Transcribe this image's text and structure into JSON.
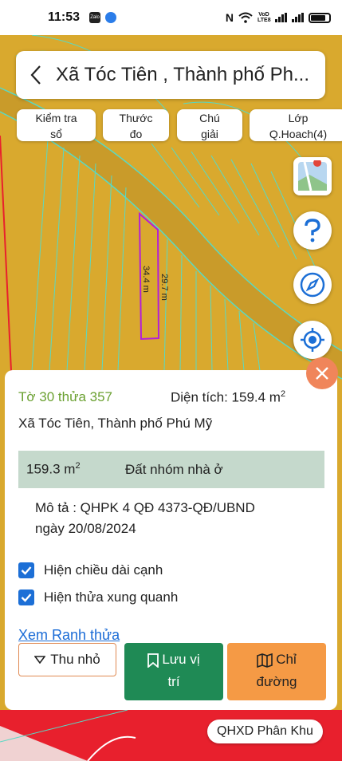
{
  "status_bar": {
    "time": "11:53",
    "app_badge": "Zalo",
    "network": [
      "VoD",
      "LTE8"
    ]
  },
  "search": {
    "title": "Xã Tóc Tiên , Thành phố Ph..."
  },
  "toolbar": {
    "check_line1": "Kiểm tra",
    "check_line2": "sổ",
    "ruler_line1": "Thước",
    "ruler_line2": "đo",
    "legend_line1": "Chú",
    "legend_line2": "giải",
    "layer_line1": "Lớp",
    "layer_line2": "Q.Hoach(4)"
  },
  "map": {
    "edge_left": "34.4 m",
    "edge_right": "29.7 m",
    "colors": {
      "residential": "#d9a92e",
      "parcel_lines": "#59d9c4",
      "road": "#c99b2a",
      "selected_parcel": "#b31fd6",
      "commercial": "#e8202d"
    }
  },
  "panel": {
    "parcel_id": "Tờ 30 thửa 357",
    "area_label": "Diện tích: 159.4 m",
    "area_unit_sup": "2",
    "address": "Xã Tóc Tiên, Thành phố Phú Mỹ",
    "land_area": "159.3 m",
    "land_area_sup": "2",
    "land_type": "Đất nhóm nhà ở",
    "desc_line1": "Mô tả : QHPK 4 QĐ 4373-QĐ/UBND",
    "desc_line2": "ngày 20/08/2024",
    "show_edge_lengths": "Hiện chiều dài cạnh",
    "show_neighbors": "Hiện thửa xung quanh",
    "view_boundary": "Xem Ranh thửa",
    "collapse_label": "Thu nhỏ",
    "save_line1": "Lưu vị",
    "save_line2": "trí",
    "route_line1": "Chỉ",
    "route_line2": "đường"
  },
  "zone_label": "QHXD Phân Khu"
}
